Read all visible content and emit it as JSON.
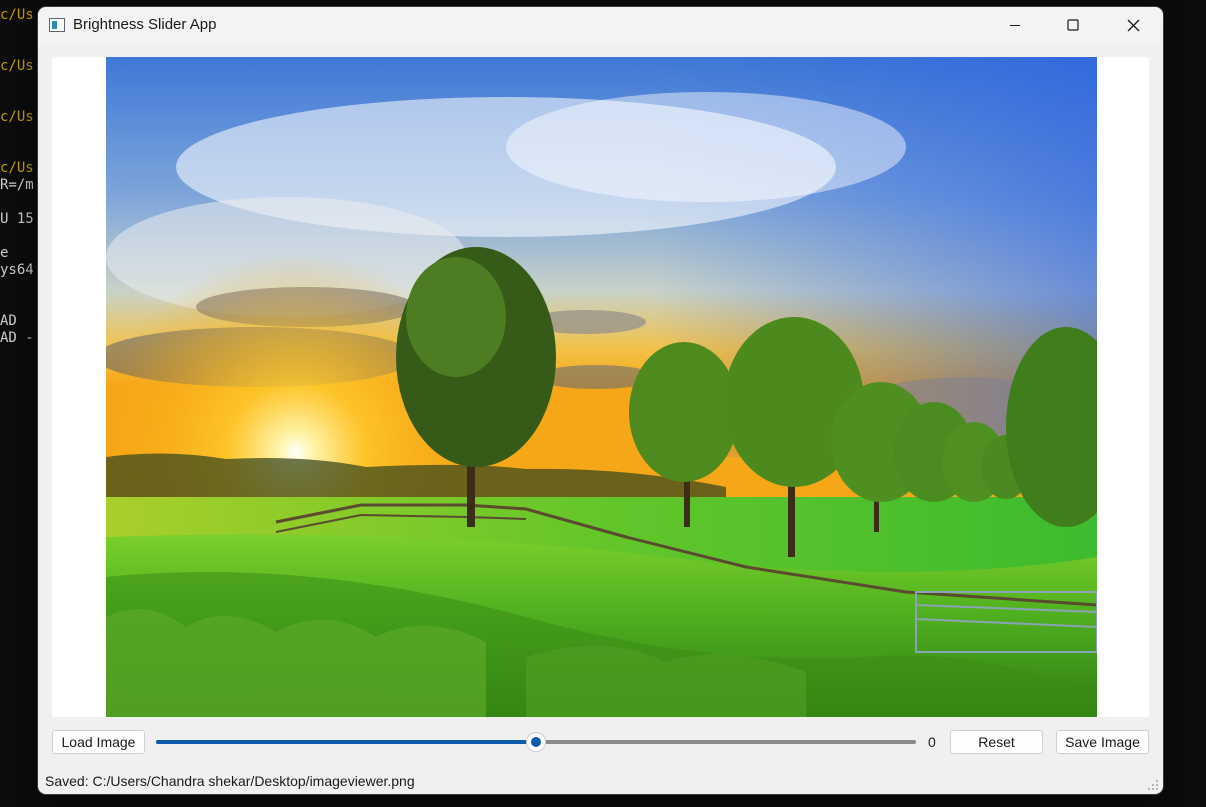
{
  "terminal": {
    "lines": [
      {
        "text": "c/Us",
        "color": "yellow"
      },
      {
        "text": "c/Us",
        "color": "yellow"
      },
      {
        "text": "c/Us",
        "color": "yellow"
      },
      {
        "text": "c/Us",
        "color": "yellow"
      },
      {
        "text": "R=/m",
        "color": "default"
      },
      {
        "text": "U 15",
        "color": "default"
      },
      {
        "text": "e",
        "color": "default"
      },
      {
        "text": "ys64",
        "color": "default"
      },
      {
        "text": "AD",
        "color": "default"
      },
      {
        "text": "AD -",
        "color": "default"
      }
    ]
  },
  "window": {
    "title": "Brightness Slider App",
    "icons": {
      "app": "app-window-icon",
      "minimize": "minimize-icon",
      "maximize": "maximize-icon",
      "close": "close-icon"
    }
  },
  "image": {
    "description_icon": "landscape-photo"
  },
  "controls": {
    "load_label": "Load Image",
    "slider_value": "0",
    "slider_fraction": 0.5,
    "reset_label": "Reset",
    "save_label": "Save Image"
  },
  "status": {
    "text": "Saved: C:/Users/Chandra shekar/Desktop/imageviewer.png"
  },
  "colors": {
    "accent": "#0b5cad",
    "window_bg": "#f0f0f0",
    "terminal_bg": "#0c0c0c",
    "terminal_yellow": "#c19c00"
  }
}
